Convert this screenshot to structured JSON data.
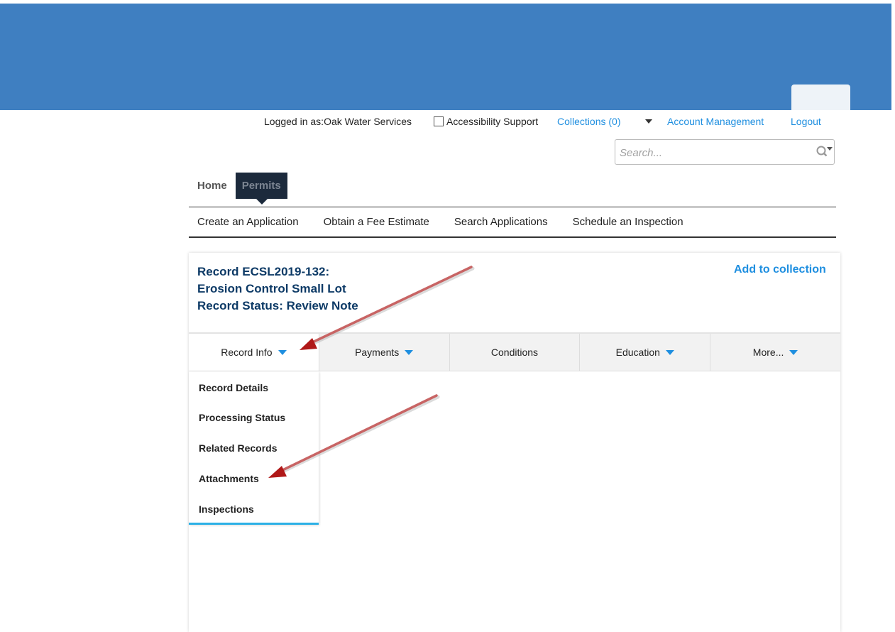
{
  "header": {
    "logged_in_label": "Logged in as:Oak Water Services",
    "accessibility_label": "Accessibility Support",
    "collections_label": "Collections (0)",
    "account_label": "Account Management",
    "logout_label": "Logout"
  },
  "search": {
    "placeholder": "Search..."
  },
  "tabs": {
    "home": "Home",
    "permits": "Permits"
  },
  "subnav": [
    "Create an Application",
    "Obtain a Fee Estimate",
    "Search Applications",
    "Schedule an Inspection"
  ],
  "record": {
    "line1": "Record ECSL2019-132:",
    "line2": "Erosion Control Small Lot",
    "line3": "Record Status: Review Note",
    "add_to_collection": "Add to collection"
  },
  "menu": [
    "Record Info",
    "Payments",
    "Conditions",
    "Education",
    "More..."
  ],
  "dropdown": [
    "Record Details",
    "Processing Status",
    "Related Records",
    "Attachments",
    "Inspections"
  ],
  "colors": {
    "banner": "#3f7fc1",
    "link": "#1f8fe0",
    "title": "#0d3a66",
    "arrow": "#b01818"
  }
}
